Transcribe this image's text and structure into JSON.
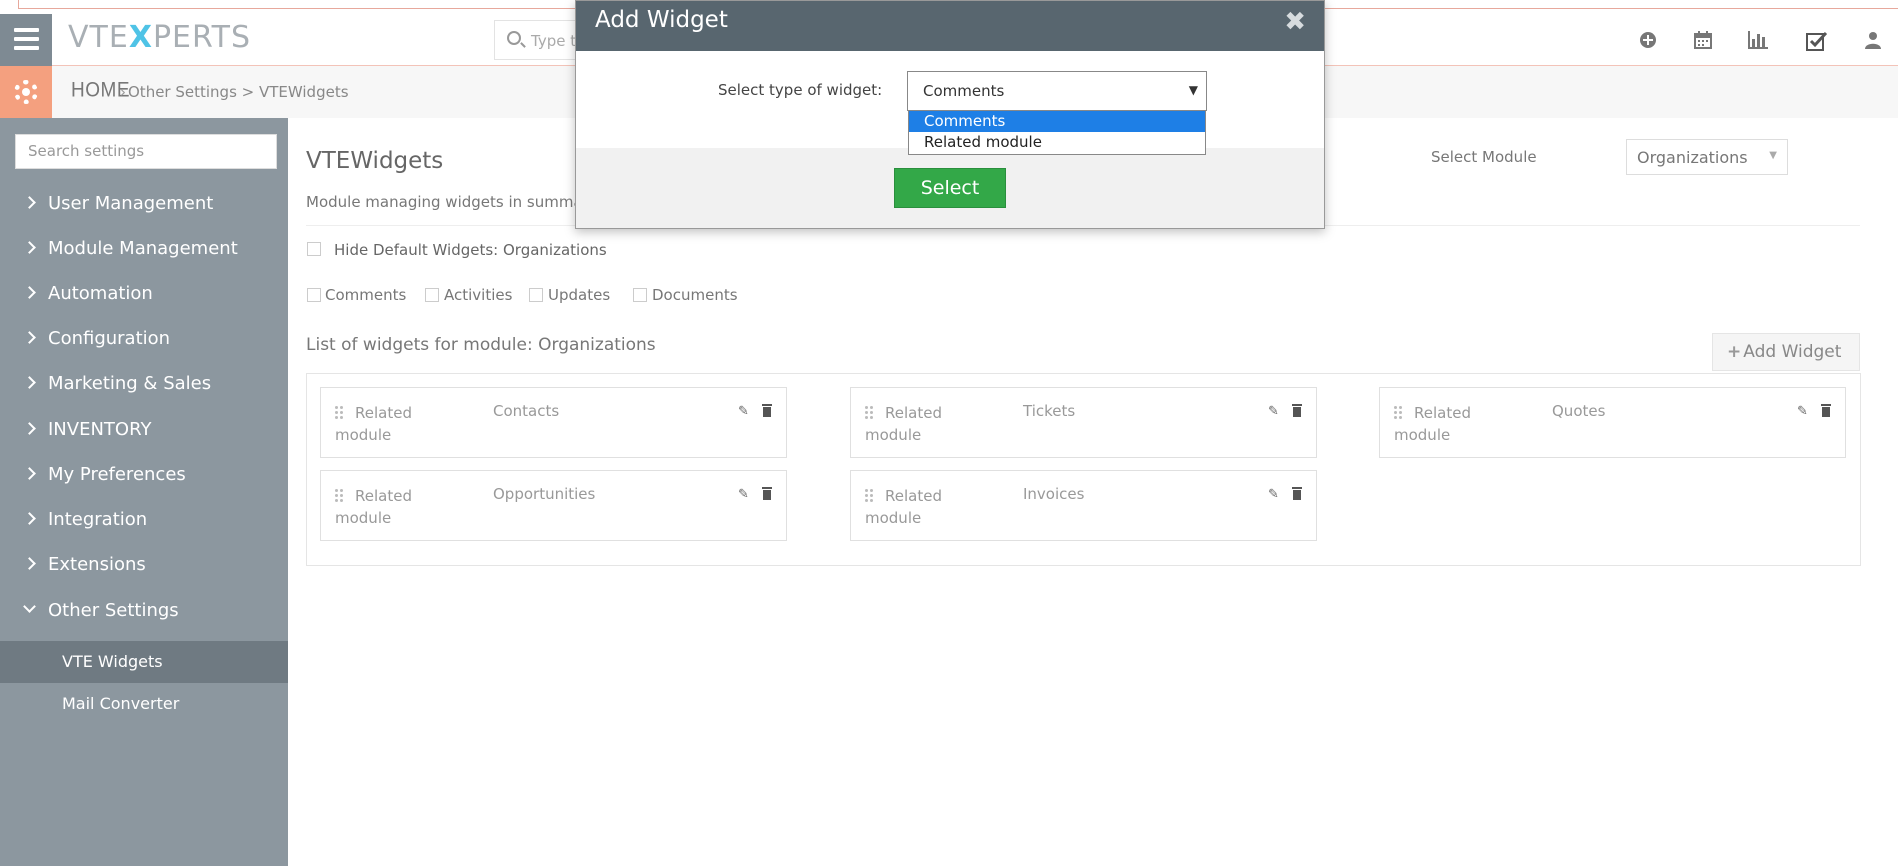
{
  "header": {
    "logo": {
      "left": "VTE",
      "x": "X",
      "right": "PERTS"
    },
    "search_placeholder": "Type t",
    "icons": [
      "plus-circle-icon",
      "calendar-icon",
      "bar-chart-icon",
      "checkbox-icon",
      "user-icon"
    ]
  },
  "breadcrumb": {
    "home": "HOME",
    "path": "Other Settings > VTEWidgets"
  },
  "sidebar": {
    "search_placeholder": "Search settings",
    "items": [
      "User Management",
      "Module Management",
      "Automation",
      "Configuration",
      "Marketing & Sales",
      "INVENTORY",
      "My Preferences",
      "Integration",
      "Extensions",
      "Other Settings"
    ],
    "subitems": [
      "VTE Widgets",
      "Mail Converter"
    ]
  },
  "main": {
    "title": "VTEWidgets",
    "description": "Module managing widgets in summary",
    "select_module_label": "Select Module",
    "select_module_value": "Organizations",
    "hide_default_label": "Hide Default Widgets: Organizations",
    "default_widgets": [
      "Comments",
      "Activities",
      "Updates",
      "Documents"
    ],
    "list_title": "List of widgets for module: Organizations",
    "add_widget_label": "Add Widget",
    "widgets": [
      {
        "type": "Related module",
        "name": "Contacts"
      },
      {
        "type": "Related module",
        "name": "Tickets"
      },
      {
        "type": "Related module",
        "name": "Quotes"
      },
      {
        "type": "Related module",
        "name": "Opportunities"
      },
      {
        "type": "Related module",
        "name": "Invoices"
      }
    ]
  },
  "modal": {
    "title": "Add Widget",
    "close_glyph": "✖",
    "label": "Select type of widget:",
    "selected": "Comments",
    "options": [
      "Comments",
      "Related module"
    ],
    "select_button": "Select"
  },
  "colors": {
    "sidebar": "#8c979f",
    "modal_header": "#58666f",
    "accent_orange": "#f4a07f",
    "select_green": "#33a848",
    "option_highlight": "#1e7fe6"
  }
}
